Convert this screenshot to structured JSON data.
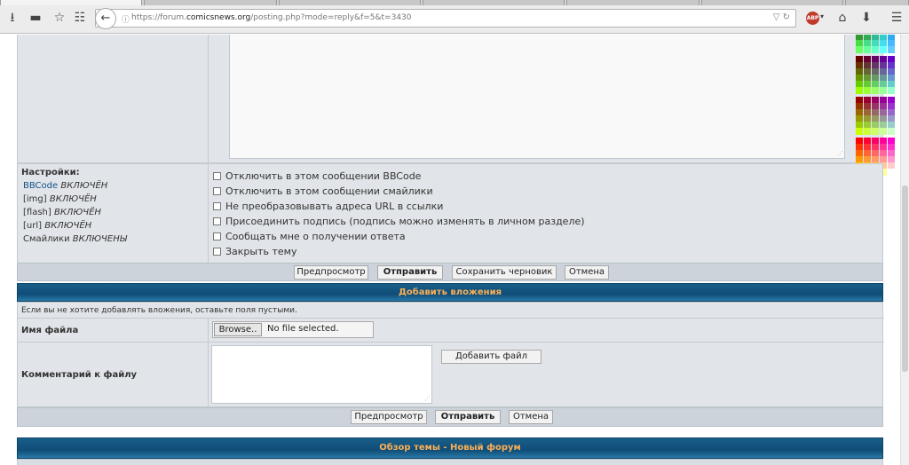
{
  "browser": {
    "url_prefix": "https://forum.",
    "url_domain": "comicsnews.org",
    "url_suffix": "/posting.php?mode=reply&f=5&t=3430",
    "abp_label": "ABP"
  },
  "settings": {
    "heading": "Настройки:",
    "bbcode_link": "BBCode",
    "bbcode_state": "ВКЛЮЧЁН",
    "img_label": "[img]",
    "img_state": "ВКЛЮЧЁН",
    "flash_label": "[flash]",
    "flash_state": "ВКЛЮЧЁН",
    "url_label": "[url]",
    "url_state": "ВКЛЮЧЁН",
    "smilies_label": "Смайлики",
    "smilies_state": "ВКЛЮЧЕНЫ"
  },
  "options": [
    "Отключить в этом сообщении BBCode",
    "Отключить в этом сообщении смайлики",
    "Не преобразовывать адреса URL в ссылки",
    "Присоединить подпись (подпись можно изменять в личном разделе)",
    "Сообщать мне о получении ответа",
    "Закрыть тему"
  ],
  "buttons1": {
    "preview": "Предпросмотр",
    "submit": "Отправить",
    "save_draft": "Сохранить черновик",
    "cancel": "Отмена"
  },
  "attach": {
    "header": "Добавить вложения",
    "hint": "Если вы не хотите добавлять вложения, оставьте поля пустыми.",
    "filename_label": "Имя файла",
    "browse": "Browse..",
    "no_file": "No file selected.",
    "comment_label": "Комментарий к файлу",
    "add_file": "Добавить файл"
  },
  "buttons2": {
    "preview": "Предпросмотр",
    "submit": "Отправить",
    "cancel": "Отмена"
  },
  "review": {
    "header": "Обзор темы - Новый форум"
  }
}
